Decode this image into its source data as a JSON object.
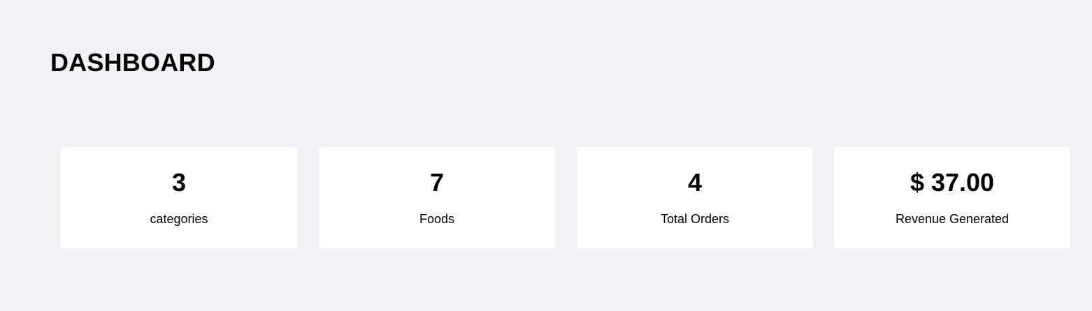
{
  "header": {
    "title": "DASHBOARD"
  },
  "stats": [
    {
      "value": "3",
      "label": "categories"
    },
    {
      "value": "7",
      "label": "Foods"
    },
    {
      "value": "4",
      "label": "Total Orders"
    },
    {
      "value": "$ 37.00",
      "label": "Revenue Generated"
    }
  ],
  "colors": {
    "background": "#f1f2f6",
    "card": "#ffffff",
    "text": "#000000"
  }
}
